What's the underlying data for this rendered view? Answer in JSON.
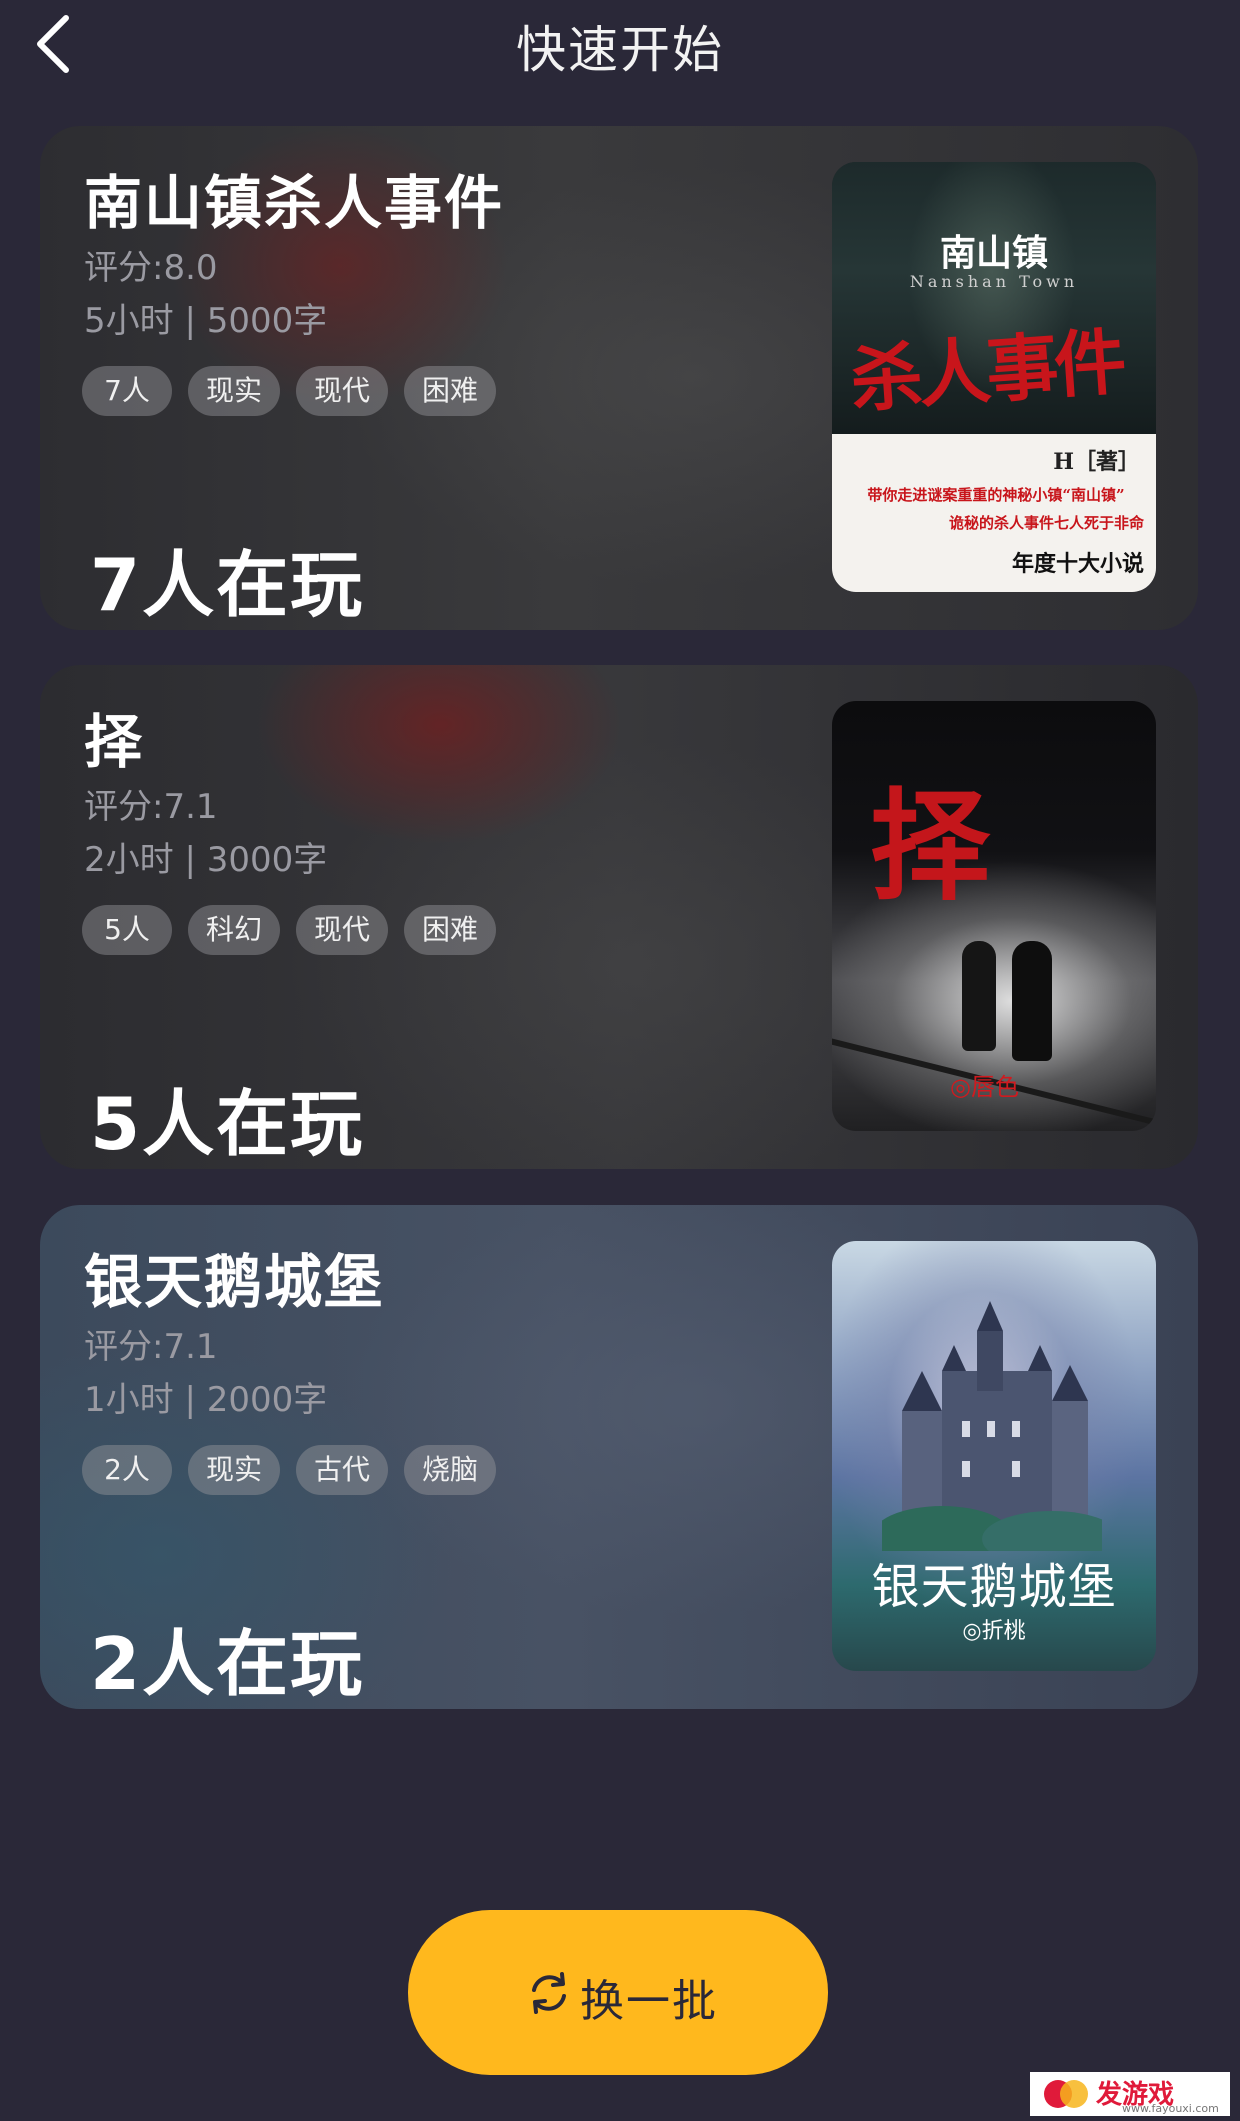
{
  "header": {
    "title": "快速开始",
    "back_icon": "chevron-left-icon"
  },
  "cards": [
    {
      "title": "南山镇杀人事件",
      "rating": "评分:8.0",
      "meta": "5小时 | 5000字",
      "tags": [
        "7人",
        "现实",
        "现代",
        "困难"
      ],
      "players": "7人在玩",
      "cover": {
        "title": "南山镇",
        "subtitle": "Nanshan Town",
        "big_text": "杀人事件",
        "author": "H［著］",
        "blurb1": "带你走进谜案重重的神秘小镇“南山镇”",
        "blurb2": "诡秘的杀人事件七人死于非命",
        "award": "年度十大小说"
      }
    },
    {
      "title": "择",
      "rating": "评分:7.1",
      "meta": "2小时 | 3000字",
      "tags": [
        "5人",
        "科幻",
        "现代",
        "困难"
      ],
      "players": "5人在玩",
      "cover": {
        "big_text": "择",
        "signature": "◎唇色"
      }
    },
    {
      "title": "银天鹅城堡",
      "rating": "评分:7.1",
      "meta": "1小时 | 2000字",
      "tags": [
        "2人",
        "现实",
        "古代",
        "烧脑"
      ],
      "players": "2人在玩",
      "cover": {
        "title": "银天鹅城堡",
        "signature": "◎折桃"
      }
    }
  ],
  "refresh_button": {
    "label": "换一批",
    "icon": "refresh-icon",
    "color": "#ffb81d"
  },
  "watermark": {
    "brand": "发游戏",
    "url": "www.fayouxi.com"
  },
  "colors": {
    "background": "#2a2838",
    "accent": "#ffb81d",
    "tag_bg": "rgba(150,150,155,0.45)"
  }
}
